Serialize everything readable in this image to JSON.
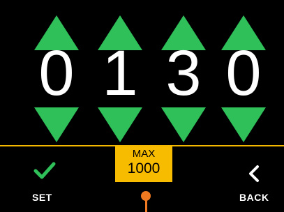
{
  "digits": [
    "0",
    "1",
    "3",
    "0"
  ],
  "max": {
    "label": "MAX",
    "value": "1000"
  },
  "buttons": {
    "set": "SET",
    "back": "BACK"
  },
  "icons": {
    "increment": "triangle-up-icon",
    "decrement": "triangle-down-icon",
    "confirm": "checkmark-icon",
    "back": "chevron-left-icon"
  },
  "colors": {
    "background": "#000000",
    "arrow": "#2fc05a",
    "accent": "#f7bc00",
    "pointer": "#f07a22",
    "text": "#ffffff"
  }
}
